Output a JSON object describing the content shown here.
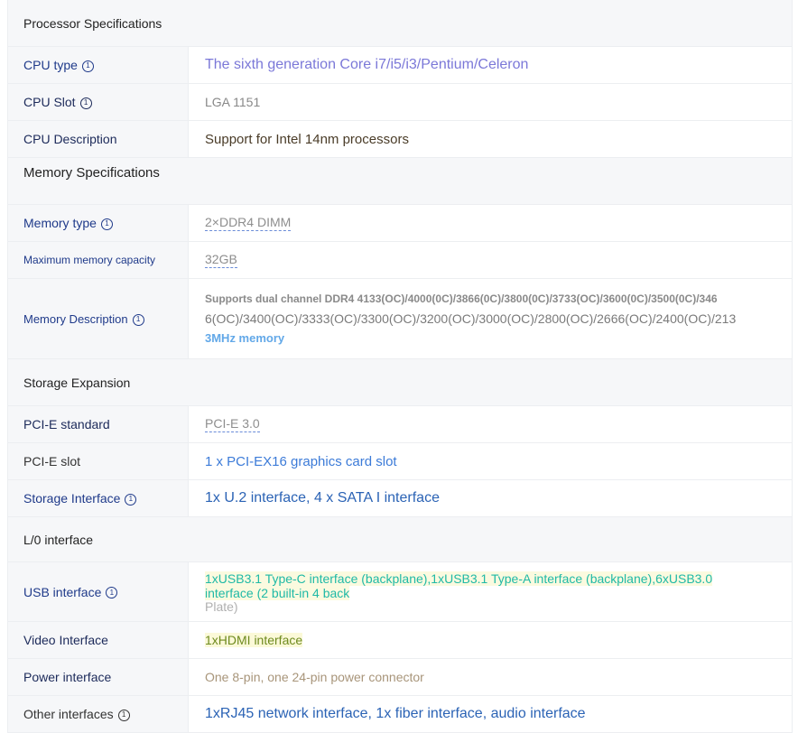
{
  "sections": {
    "processor": "Processor Specifications",
    "memory": "Memory Specifications",
    "storage": "Storage Expansion",
    "io": "L/0 interface"
  },
  "info_icon_glyph": "1",
  "rows": {
    "cpu_type": {
      "label": "CPU type",
      "value": "The sixth generation Core i7/i5/i3/Pentium/Celeron"
    },
    "cpu_slot": {
      "label": "CPU Slot",
      "value": "LGA 1151"
    },
    "cpu_desc": {
      "label": "CPU Description",
      "value": "Support for Intel 14nm processors"
    },
    "mem_type": {
      "label": "Memory type",
      "value": "2×DDR4 DIMM"
    },
    "mem_max": {
      "label": "Maximum memory capacity",
      "value": "32GB"
    },
    "mem_desc": {
      "label": "Memory Description",
      "line1": "Supports dual channel DDR4 4133(OC)/4000(0C)/3866(0C)/3800(0C)/3733(OC)/3600(0C)/3500(0C)/346",
      "line2": "6(OC)/3400(OC)/3333(OC)/3300(OC)/3200(OC)/3000(OC)/2800(OC)/2666(OC)/2400(OC)/213",
      "line3": "3MHz memory"
    },
    "pcie_std": {
      "label": "PCI-E standard",
      "value": "PCI-E 3.0"
    },
    "pcie_slot": {
      "label": "PCI-E slot",
      "value": "1 x PCI-EX16 graphics card slot"
    },
    "storage_if": {
      "label": "Storage Interface",
      "value": "1x U.2 interface, 4 x SATA I interface"
    },
    "usb_if": {
      "label": "USB interface",
      "line1": "1xUSB3.1 Type-C interface (backplane),1xUSB3.1 Type-A interface (backplane),6xUSB3.0",
      "line2": "interface (2 built-in 4 back",
      "line3": "Plate)"
    },
    "video_if": {
      "label": "Video Interface",
      "value": "1xHDMI interface"
    },
    "power_if": {
      "label": "Power interface",
      "value": "One 8-pin, one 24-pin power connector"
    },
    "other_if": {
      "label": "Other interfaces",
      "value": "1xRJ45 network interface, 1x fiber interface, audio interface"
    }
  }
}
